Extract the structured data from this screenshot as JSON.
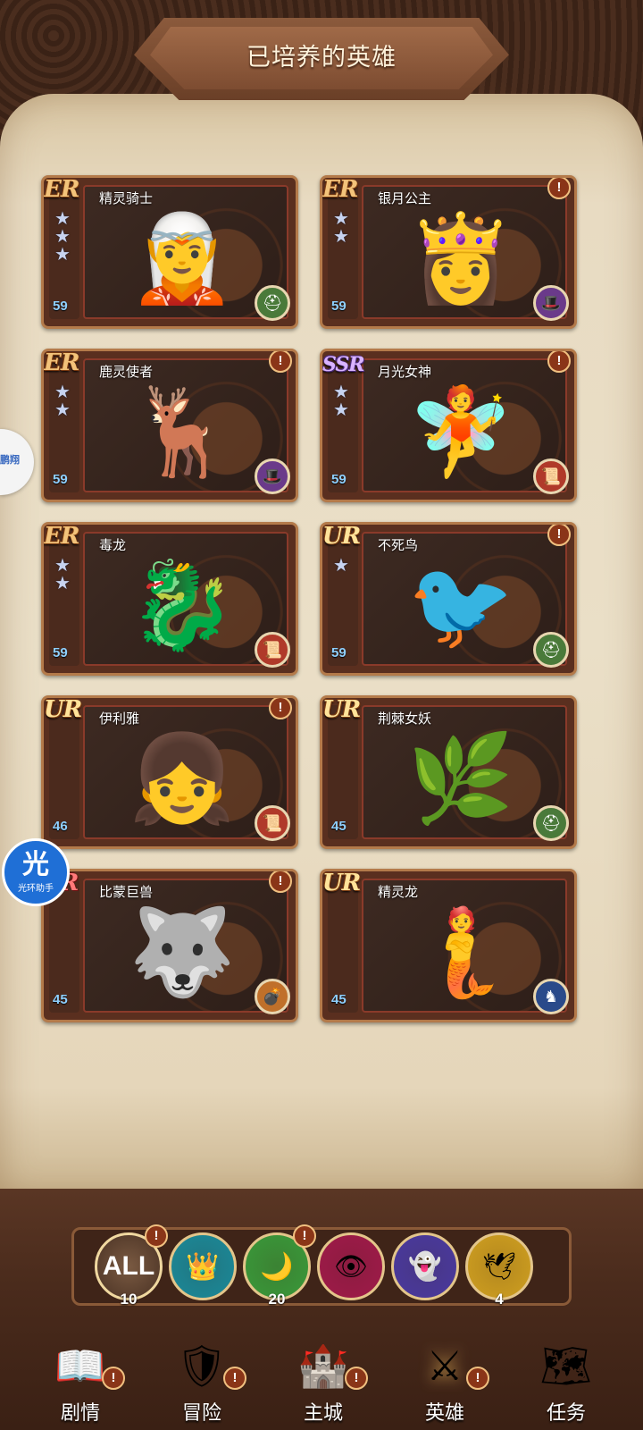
{
  "title": "已培养的英雄",
  "heroes": [
    {
      "name": "精灵骑士",
      "rarity": "ER",
      "level": "59",
      "stars": 3,
      "alert": false,
      "class_icon": "helmet-icon",
      "class_color": "#4a7a3a",
      "art": "🧝"
    },
    {
      "name": "银月公主",
      "rarity": "ER",
      "level": "59",
      "stars": 2,
      "alert": true,
      "class_icon": "mage-hat-icon",
      "class_color": "#6a3a8a",
      "art": "👸"
    },
    {
      "name": "鹿灵使者",
      "rarity": "ER",
      "level": "59",
      "stars": 2,
      "alert": true,
      "class_icon": "mage-hat-icon",
      "class_color": "#6a3a8a",
      "art": "🦌"
    },
    {
      "name": "月光女神",
      "rarity": "SSR",
      "level": "59",
      "stars": 2,
      "alert": true,
      "class_icon": "scroll-icon",
      "class_color": "#b03a2a",
      "art": "🧚"
    },
    {
      "name": "毒龙",
      "rarity": "ER",
      "level": "59",
      "stars": 2,
      "alert": false,
      "class_icon": "scroll-icon",
      "class_color": "#b03a2a",
      "art": "🐉"
    },
    {
      "name": "不死鸟",
      "rarity": "UR",
      "level": "59",
      "stars": 1,
      "alert": true,
      "class_icon": "helmet-icon",
      "class_color": "#4a7a3a",
      "art": "🐦"
    },
    {
      "name": "伊利雅",
      "rarity": "UR",
      "level": "46",
      "stars": 0,
      "alert": true,
      "class_icon": "scroll-icon",
      "class_color": "#b03a2a",
      "art": "👧"
    },
    {
      "name": "荆棘女妖",
      "rarity": "UR",
      "level": "45",
      "stars": 0,
      "alert": false,
      "class_icon": "helmet-icon",
      "class_color": "#4a7a3a",
      "art": "🌿"
    },
    {
      "name": "比蒙巨兽",
      "rarity": "SR",
      "level": "45",
      "stars": 0,
      "alert": true,
      "class_icon": "cannon-icon",
      "class_color": "#c0702a",
      "art": "🐺"
    },
    {
      "name": "精灵龙",
      "rarity": "UR",
      "level": "45",
      "stars": 0,
      "alert": false,
      "class_icon": "knight-icon",
      "class_color": "#2a4a8a",
      "art": "🧜"
    }
  ],
  "side_widget": {
    "text": "鹏翔"
  },
  "assistant": {
    "big": "光",
    "small": "光环助手"
  },
  "filters": [
    {
      "label": "ALL",
      "count": "10",
      "alert": true,
      "icon": "all-icon",
      "color": "#5a3e2c"
    },
    {
      "label": "",
      "count": "",
      "alert": false,
      "icon": "crown-icon",
      "color": "#1a8a9a"
    },
    {
      "label": "",
      "count": "20",
      "alert": true,
      "icon": "moon-icon",
      "color": "#3a9a3a"
    },
    {
      "label": "",
      "count": "",
      "alert": false,
      "icon": "eye-icon",
      "color": "#a01a4a"
    },
    {
      "label": "",
      "count": "",
      "alert": false,
      "icon": "ghost-icon",
      "color": "#4a3aa0"
    },
    {
      "label": "",
      "count": "4",
      "alert": false,
      "icon": "wings-icon",
      "color": "#d0a020"
    }
  ],
  "nav": [
    {
      "label": "剧情",
      "icon": "book-icon",
      "alert": true,
      "active": false
    },
    {
      "label": "冒险",
      "icon": "shield-icon",
      "alert": true,
      "active": false
    },
    {
      "label": "主城",
      "icon": "castle-icon",
      "alert": true,
      "active": false
    },
    {
      "label": "英雄",
      "icon": "helmet-icon",
      "alert": true,
      "active": true
    },
    {
      "label": "任务",
      "icon": "map-icon",
      "alert": false,
      "active": false
    }
  ]
}
